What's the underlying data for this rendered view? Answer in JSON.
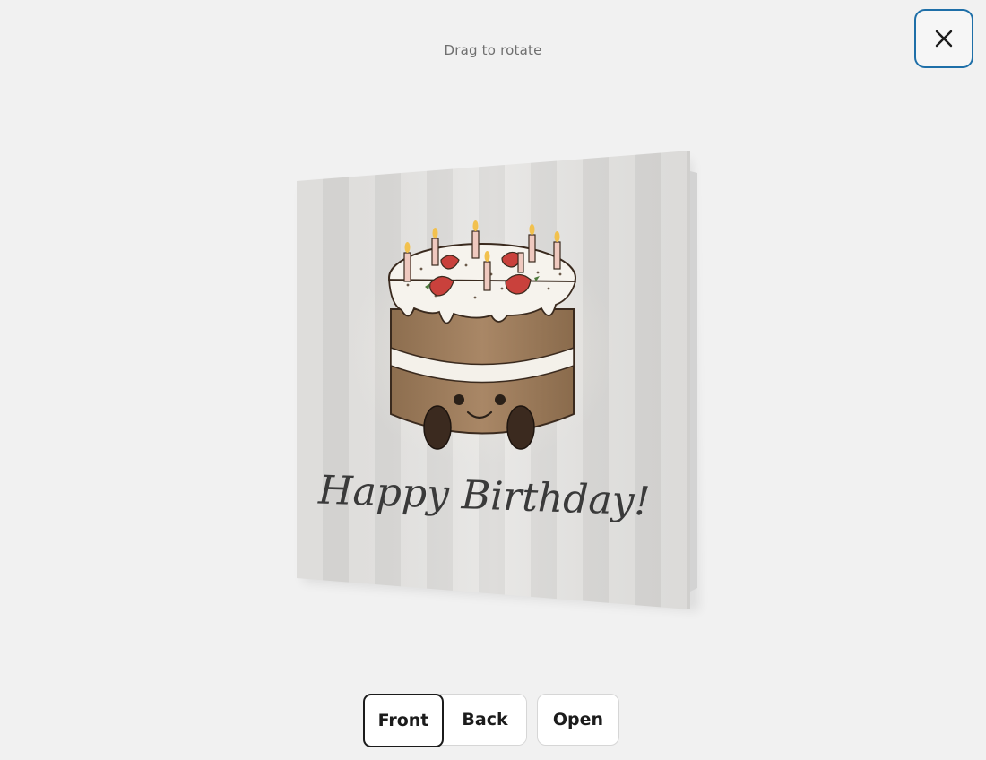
{
  "viewer": {
    "hint": "Drag to rotate",
    "close_icon": "close-icon"
  },
  "card": {
    "greeting": "Happy Birthday!",
    "illustration": "birthday-cake-with-candles-and-strawberries"
  },
  "controls": {
    "views": [
      {
        "label": "Front",
        "selected": true
      },
      {
        "label": "Back",
        "selected": false
      }
    ],
    "open_label": "Open"
  },
  "colors": {
    "background": "#f1f1f1",
    "close_border": "#1e6fa8",
    "selected_border": "#1b1b1b"
  }
}
